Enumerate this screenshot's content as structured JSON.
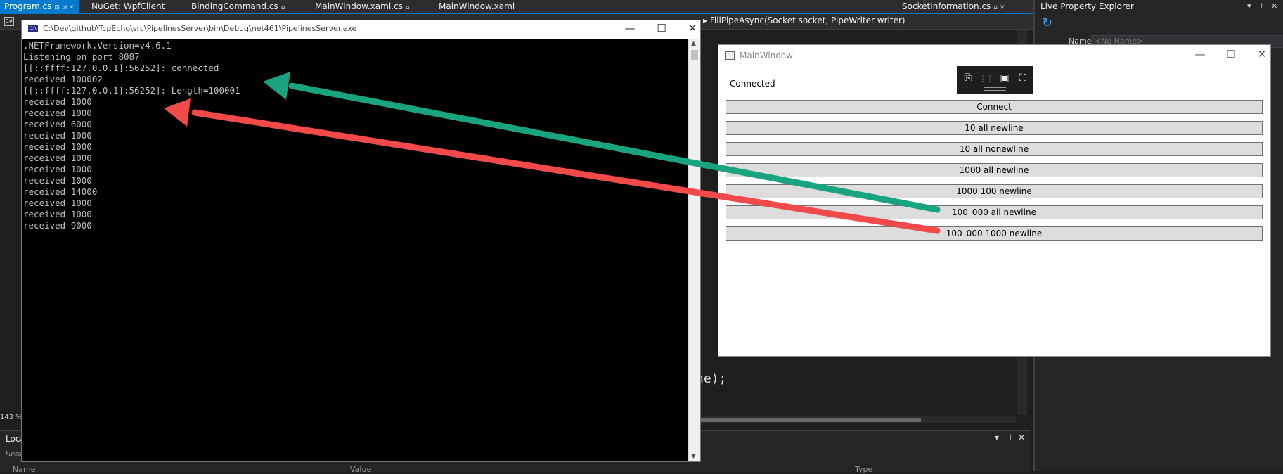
{
  "vs": {
    "tabs": [
      {
        "label": "Program.cs",
        "active": true
      },
      {
        "label": "NuGet: WpfClient"
      },
      {
        "label": "BindingCommand.cs"
      },
      {
        "label": "MainWindow.xaml.cs"
      },
      {
        "label": "MainWindow.xaml"
      },
      {
        "label": "SocketInformation.cs"
      }
    ],
    "navbar_method": "FillPipeAsync(Socket socket, PipeWriter writer)",
    "code_fragment": "ne);",
    "zoom": "143 %",
    "bottom_panel": {
      "title": "Loca",
      "search_placeholder": "Sear",
      "columns": [
        "Name",
        "Value",
        "Type"
      ]
    },
    "live_property_explorer": {
      "title": "Live Property Explorer",
      "name_label": "Name",
      "name_value": "<No Name>"
    }
  },
  "console": {
    "title": "C:\\Dev\\github\\TcpEcho\\src\\PipelinesServer\\bin\\Debug\\net461\\PipelinesServer.exe",
    "lines": [
      ".NETFramework,Version=v4.6.1",
      "Listening on port 8087",
      "[[::ffff:127.0.0.1]:56252]: connected",
      "received 100002",
      "[[::ffff:127.0.0.1]:56252]: Length=100001",
      "received 1000",
      "received 1000",
      "received 6000",
      "received 1000",
      "received 1000",
      "received 1000",
      "received 1000",
      "received 1000",
      "received 14000",
      "received 1000",
      "received 1000",
      "received 9000"
    ]
  },
  "mainwindow": {
    "title": "MainWindow",
    "status": "Connected",
    "buttons": [
      "Connect",
      "10 all newline",
      "10 all nonewline",
      "1000 all newline",
      "1000 100 newline",
      "100_000 all newline",
      "100_000 1000 newline"
    ]
  },
  "colors": {
    "vs_accent": "#007acc",
    "arrow_green": "#1aa37f",
    "arrow_red": "#f24a4a"
  }
}
